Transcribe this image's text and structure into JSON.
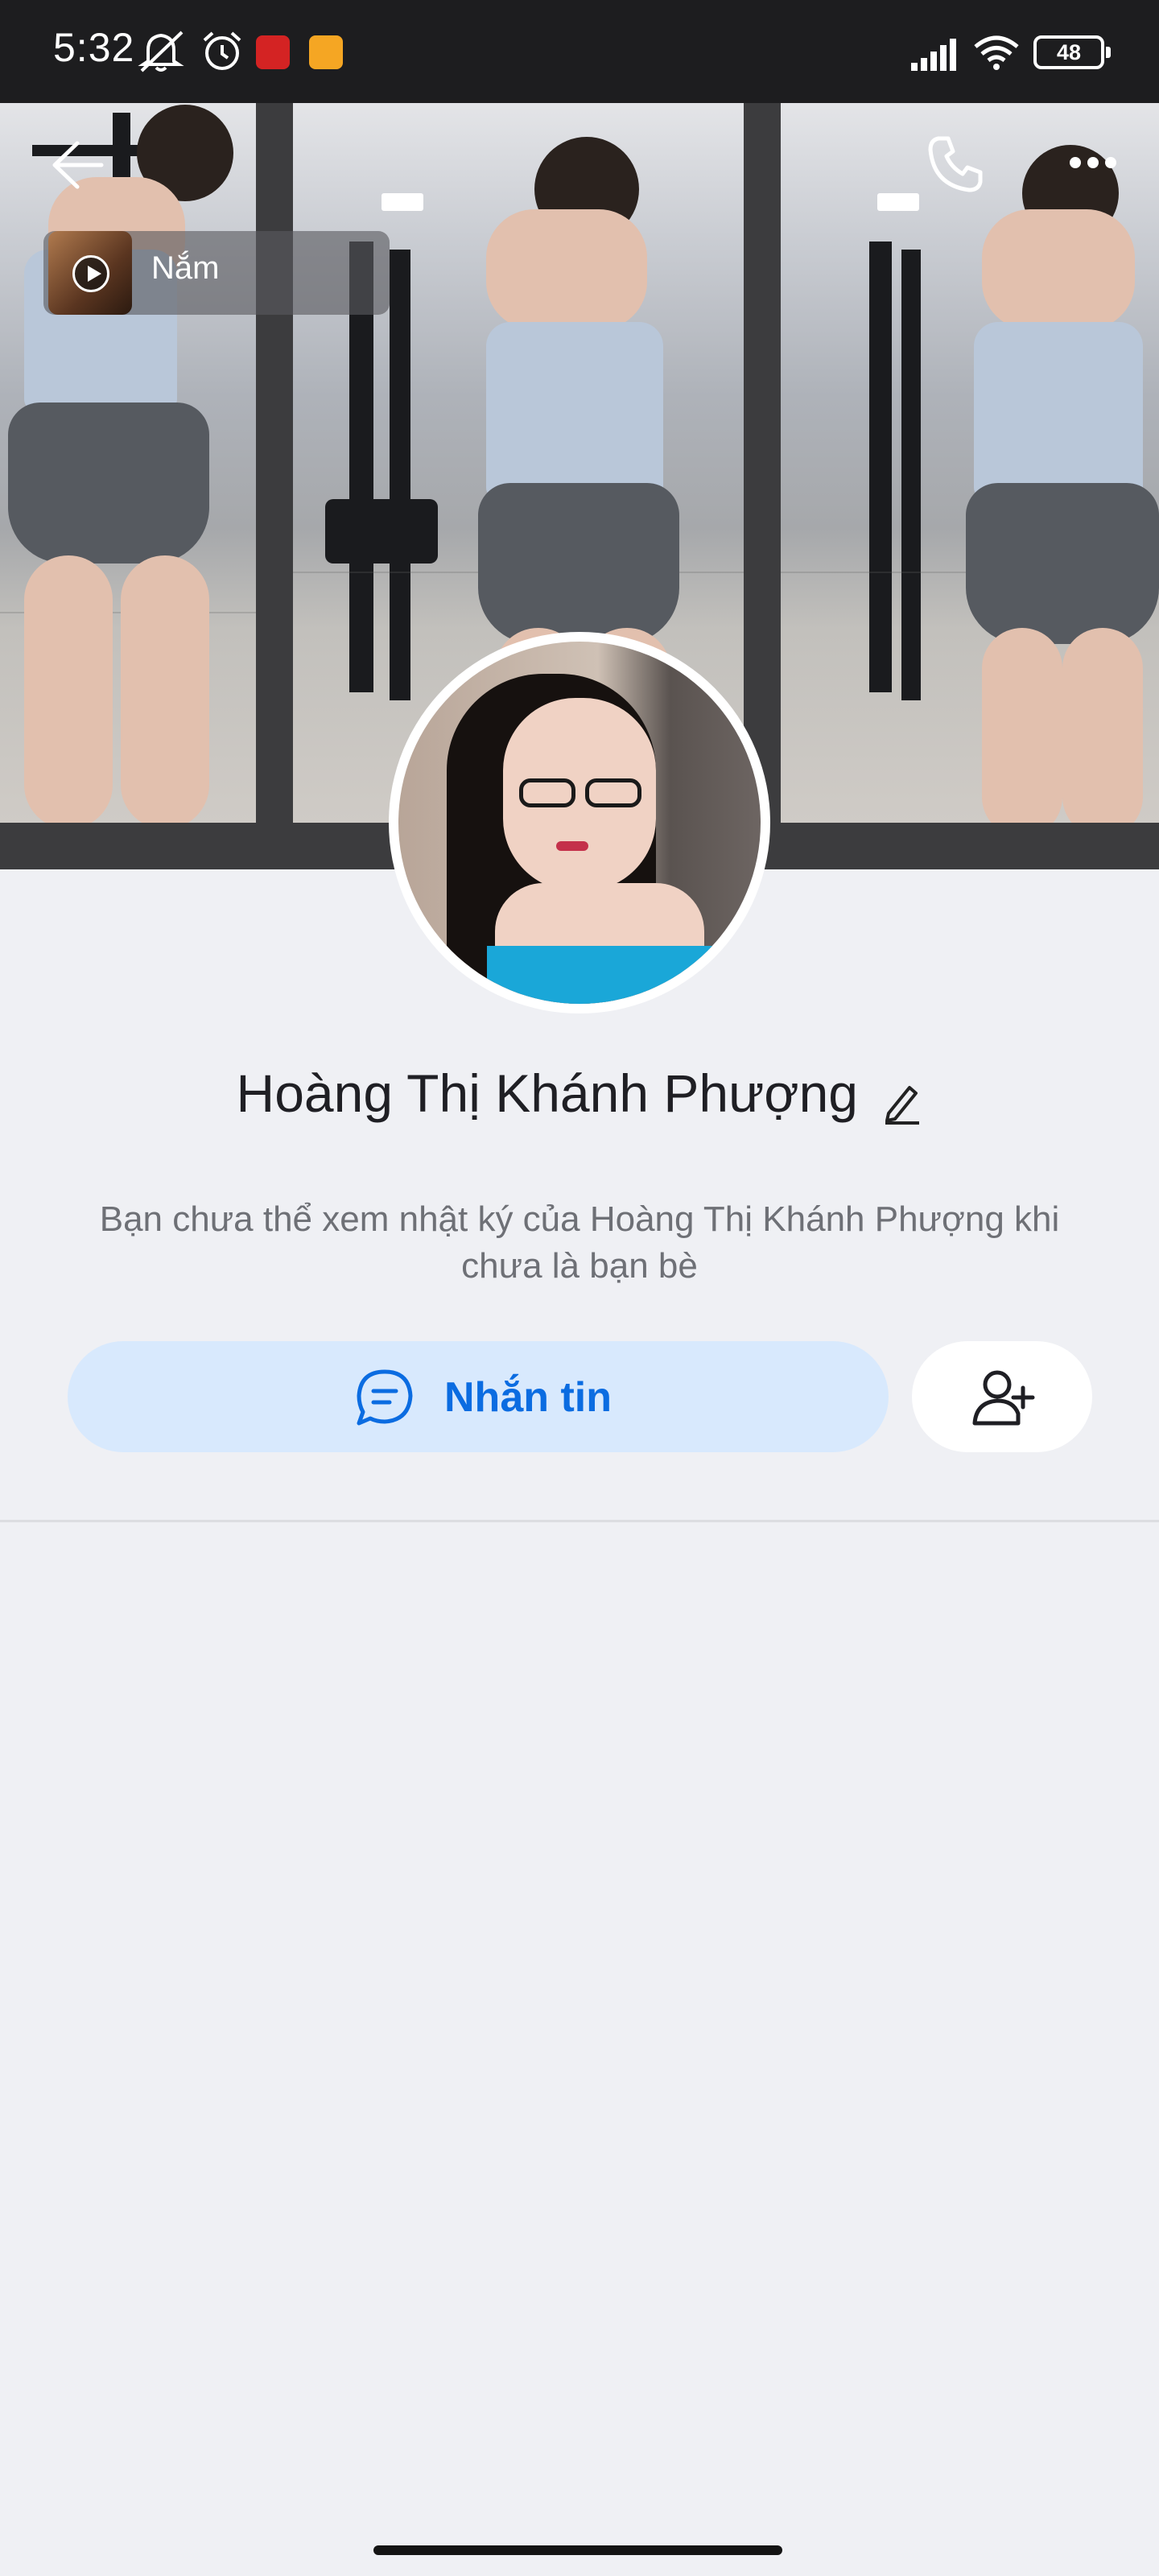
{
  "status_bar": {
    "time": "5:32",
    "battery": "48",
    "icons": [
      "mute-bell-icon",
      "alarm-icon",
      "app-notification-red-icon",
      "app-notification-yellow-icon",
      "signal-icon",
      "wifi-icon",
      "battery-icon"
    ]
  },
  "header": {
    "icons": [
      "back-arrow-icon",
      "phone-icon",
      "more-dots-icon"
    ]
  },
  "music": {
    "title": "Nắm"
  },
  "profile": {
    "name": "Hoàng Thị Khánh Phượng",
    "privacy_note": "Bạn chưa thể xem nhật ký của Hoàng Thị Khánh Phượng khi chưa là bạn bè"
  },
  "actions": {
    "message_label": "Nhắn tin"
  },
  "colors": {
    "accent": "#0b6ce1",
    "message_button_bg": "#d8e9fd",
    "page_bg": "#eff0f4"
  }
}
